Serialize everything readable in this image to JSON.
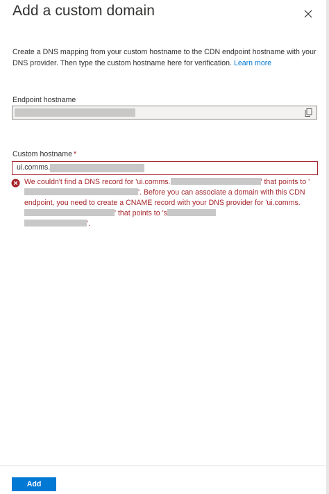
{
  "panel": {
    "title": "Add a custom domain",
    "close_icon": "close-icon"
  },
  "description": {
    "text": "Create a DNS mapping from your custom hostname to the CDN endpoint hostname with your DNS provider. Then type the custom hostname here for verification.",
    "link_label": "Learn more"
  },
  "endpoint": {
    "label": "Endpoint hostname",
    "copy_icon": "copy-icon"
  },
  "custom_hostname": {
    "label": "Custom hostname",
    "required_marker": "*",
    "value": "ui.comms.s"
  },
  "error": {
    "icon": "error-circle-icon",
    "part1": "We couldn't find a DNS record for 'ui.comms.",
    "part2": "' that points to '",
    "part3": "'. Before you can associate a domain with this CDN endpoint, you need to create a CNAME record with your DNS provider for 'ui.comms.",
    "part4": "' that points to 's",
    "part5": "'."
  },
  "footer": {
    "add_label": "Add"
  },
  "colors": {
    "accent": "#0078d4",
    "error": "#a4262c"
  }
}
